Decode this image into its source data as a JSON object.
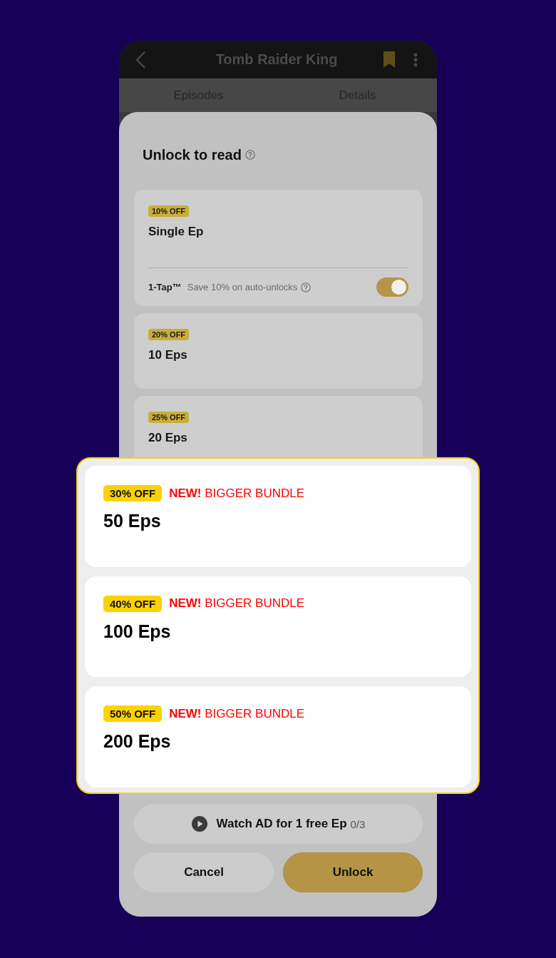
{
  "app_bar": {
    "title": "Tomb Raider King"
  },
  "tabs": [
    {
      "label": "Episodes"
    },
    {
      "label": "Details"
    }
  ],
  "sheet": {
    "title": "Unlock to read",
    "plans": [
      {
        "badge": "10% OFF",
        "name": "Single Ep",
        "one_tap": {
          "label": "1-Tap™",
          "description": "Save 10% on auto-unlocks",
          "on": true
        }
      },
      {
        "badge": "20% OFF",
        "name": "10 Eps"
      },
      {
        "badge": "25% OFF",
        "name": "20 Eps"
      }
    ],
    "watch_ad": {
      "label": "Watch AD for 1 free Ep",
      "count": "0/3"
    },
    "buttons": [
      {
        "label": "Cancel",
        "kind": "secondary"
      },
      {
        "label": "Unlock",
        "kind": "primary"
      }
    ]
  },
  "callout": {
    "plans": [
      {
        "badge": "30% OFF",
        "tag": "**NEW!** BIGGER BUNDLE",
        "name": "50 Eps"
      },
      {
        "badge": "40% OFF",
        "tag": "**NEW!** BIGGER BUNDLE",
        "name": "100 Eps"
      },
      {
        "badge": "50% OFF",
        "tag": "**NEW!** BIGGER BUNDLE",
        "name": "200 Eps"
      }
    ]
  }
}
